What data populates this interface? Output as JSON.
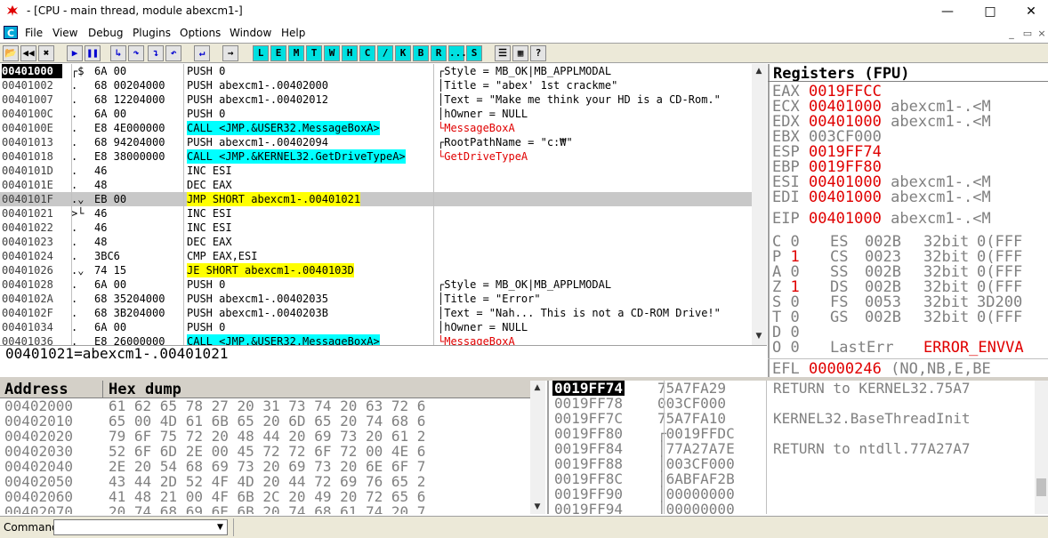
{
  "window": {
    "title": "- [CPU - main thread, module abexcm1-]",
    "minimize_icon": "minimize-icon",
    "maximize_icon": "maximize-icon",
    "close_icon": "close-icon"
  },
  "menu": {
    "items": [
      "File",
      "View",
      "Debug",
      "Plugins",
      "Options",
      "Window",
      "Help"
    ],
    "c_icon": "C"
  },
  "toolbar": {
    "letter_buttons": [
      "L",
      "E",
      "M",
      "T",
      "W",
      "H",
      "C",
      "/",
      "K",
      "B",
      "R",
      "...",
      "S"
    ]
  },
  "cpu": {
    "rows": [
      {
        "addr": "00401000",
        "mark": "┌$",
        "hex": "6A 00",
        "dis": "PUSH 0",
        "com": "┌Style = MB_OK|MB_APPLMODAL",
        "sel": true
      },
      {
        "addr": "00401002",
        "mark": ".",
        "hex": "68 00204000",
        "dis": "PUSH abexcm1-.00402000",
        "com": "│Title = \"abex' 1st crackme\""
      },
      {
        "addr": "00401007",
        "mark": ".",
        "hex": "68 12204000",
        "dis": "PUSH abexcm1-.00402012",
        "com": "│Text = \"Make me think your HD is a CD-Rom.\""
      },
      {
        "addr": "0040100C",
        "mark": ".",
        "hex": "6A 00",
        "dis": "PUSH 0",
        "com": "│hOwner = NULL"
      },
      {
        "addr": "0040100E",
        "mark": ".",
        "hex": "E8 4E000000",
        "dis": "CALL <JMP.&USER32.MessageBoxA>",
        "com": "└MessageBoxA",
        "call": true
      },
      {
        "addr": "00401013",
        "mark": ".",
        "hex": "68 94204000",
        "dis": "PUSH abexcm1-.00402094",
        "com": "┌RootPathName = \"c:₩\""
      },
      {
        "addr": "00401018",
        "mark": ".",
        "hex": "E8 38000000",
        "dis": "CALL <JMP.&KERNEL32.GetDriveTypeA>",
        "com": "└GetDriveTypeA",
        "call": true
      },
      {
        "addr": "0040101D",
        "mark": ".",
        "hex": "46",
        "dis": "INC ESI",
        "com": ""
      },
      {
        "addr": "0040101E",
        "mark": ".",
        "hex": "48",
        "dis": "DEC EAX",
        "com": ""
      },
      {
        "addr": "0040101F",
        "mark": ".⌄",
        "hex": "EB 00",
        "dis": "JMP SHORT abexcm1-.00401021",
        "com": "",
        "cur": true
      },
      {
        "addr": "00401021",
        "mark": ">└",
        "hex": "46",
        "dis": "INC ESI",
        "com": ""
      },
      {
        "addr": "00401022",
        "mark": ".",
        "hex": "46",
        "dis": "INC ESI",
        "com": ""
      },
      {
        "addr": "00401023",
        "mark": ".",
        "hex": "48",
        "dis": "DEC EAX",
        "com": ""
      },
      {
        "addr": "00401024",
        "mark": ".",
        "hex": "3BC6",
        "dis": "CMP EAX,ESI",
        "com": ""
      },
      {
        "addr": "00401026",
        "mark": ".⌄",
        "hex": "74 15",
        "dis": "JE SHORT abexcm1-.0040103D",
        "com": "",
        "je": true
      },
      {
        "addr": "00401028",
        "mark": ".",
        "hex": "6A 00",
        "dis": "PUSH 0",
        "com": "┌Style = MB_OK|MB_APPLMODAL"
      },
      {
        "addr": "0040102A",
        "mark": ".",
        "hex": "68 35204000",
        "dis": "PUSH abexcm1-.00402035",
        "com": "│Title = \"Error\""
      },
      {
        "addr": "0040102F",
        "mark": ".",
        "hex": "68 3B204000",
        "dis": "PUSH abexcm1-.0040203B",
        "com": "│Text = \"Nah... This is not a CD-ROM Drive!\""
      },
      {
        "addr": "00401034",
        "mark": ".",
        "hex": "6A 00",
        "dis": "PUSH 0",
        "com": "│hOwner = NULL"
      },
      {
        "addr": "00401036",
        "mark": ".",
        "hex": "E8 26000000",
        "dis": "CALL <JMP.&USER32.MessageBoxA>",
        "com": "└MessageBoxA",
        "call": true
      }
    ],
    "info": "00401021=abexcm1-.00401021"
  },
  "registers": {
    "header": "Registers (FPU)",
    "gp": [
      {
        "name": "EAX",
        "val": "0019FFCC",
        "extra": ""
      },
      {
        "name": "ECX",
        "val": "00401000",
        "extra": "abexcm1-.<M"
      },
      {
        "name": "EDX",
        "val": "00401000",
        "extra": "abexcm1-.<M"
      },
      {
        "name": "EBX",
        "val": "003CF000",
        "extra": "",
        "gray": true
      },
      {
        "name": "ESP",
        "val": "0019FF74",
        "extra": ""
      },
      {
        "name": "EBP",
        "val": "0019FF80",
        "extra": ""
      },
      {
        "name": "ESI",
        "val": "00401000",
        "extra": "abexcm1-.<M"
      },
      {
        "name": "EDI",
        "val": "00401000",
        "extra": "abexcm1-.<M"
      }
    ],
    "eip": {
      "name": "EIP",
      "val": "00401000",
      "extra": "abexcm1-.<M"
    },
    "flags": [
      {
        "f": "C",
        "v": "0",
        "seg": "ES",
        "sv": "002B",
        "bits": "32bit",
        "rest": "0(FFF"
      },
      {
        "f": "P",
        "v": "1",
        "seg": "CS",
        "sv": "0023",
        "bits": "32bit",
        "rest": "0(FFF",
        "red": true
      },
      {
        "f": "A",
        "v": "0",
        "seg": "SS",
        "sv": "002B",
        "bits": "32bit",
        "rest": "0(FFF"
      },
      {
        "f": "Z",
        "v": "1",
        "seg": "DS",
        "sv": "002B",
        "bits": "32bit",
        "rest": "0(FFF",
        "red": true
      },
      {
        "f": "S",
        "v": "0",
        "seg": "FS",
        "sv": "0053",
        "bits": "32bit",
        "rest": "3D200"
      },
      {
        "f": "T",
        "v": "0",
        "seg": "GS",
        "sv": "002B",
        "bits": "32bit",
        "rest": "0(FFF"
      },
      {
        "f": "D",
        "v": "0",
        "seg": "",
        "sv": "",
        "bits": "",
        "rest": ""
      },
      {
        "f": "O",
        "v": "0",
        "seg": "LastErr",
        "sv": "",
        "bits": "",
        "rest": "ERROR_ENVVA"
      }
    ],
    "efl": {
      "name": "EFL",
      "val": "00000246",
      "rest": "(NO,NB,E,BE"
    }
  },
  "dump": {
    "headers": [
      "Address",
      "Hex dump"
    ],
    "rows": [
      {
        "addr": "00402000",
        "hex": "61 62 65 78 27 20 31 73 74 20 63 72 6"
      },
      {
        "addr": "00402010",
        "hex": "65 00 4D 61 6B 65 20 6D 65 20 74 68 6"
      },
      {
        "addr": "00402020",
        "hex": "79 6F 75 72 20 48 44 20 69 73 20 61 2"
      },
      {
        "addr": "00402030",
        "hex": "52 6F 6D 2E 00 45 72 72 6F 72 00 4E 6"
      },
      {
        "addr": "00402040",
        "hex": "2E 20 54 68 69 73 20 69 73 20 6E 6F 7"
      },
      {
        "addr": "00402050",
        "hex": "43 44 2D 52 4F 4D 20 44 72 69 76 65 2"
      },
      {
        "addr": "00402060",
        "hex": "41 48 21 00 4F 6B 2C 20 49 20 72 65 6"
      },
      {
        "addr": "00402070",
        "hex": "20 74 68 69 6E 6B 20 74 68 61 74 20 7"
      }
    ]
  },
  "stack": {
    "rows": [
      {
        "addr": "0019FF74",
        "val": "75A7FA29",
        "com": "RETURN to KERNEL32.75A7",
        "sel": true
      },
      {
        "addr": "0019FF78",
        "val": "003CF000",
        "com": ""
      },
      {
        "addr": "0019FF7C",
        "val": "75A7FA10",
        "com": "KERNEL32.BaseThreadInit"
      },
      {
        "addr": "0019FF80",
        "val": "┌0019FFDC",
        "com": ""
      },
      {
        "addr": "0019FF84",
        "val": "│77A27A7E",
        "com": "RETURN to ntdll.77A27A7"
      },
      {
        "addr": "0019FF88",
        "val": "│003CF000",
        "com": ""
      },
      {
        "addr": "0019FF8C",
        "val": "│6ABFAF2B",
        "com": ""
      },
      {
        "addr": "0019FF90",
        "val": "│00000000",
        "com": ""
      },
      {
        "addr": "0019FF94",
        "val": "│00000000",
        "com": ""
      }
    ]
  },
  "command": {
    "label": "Command :",
    "value": ""
  }
}
